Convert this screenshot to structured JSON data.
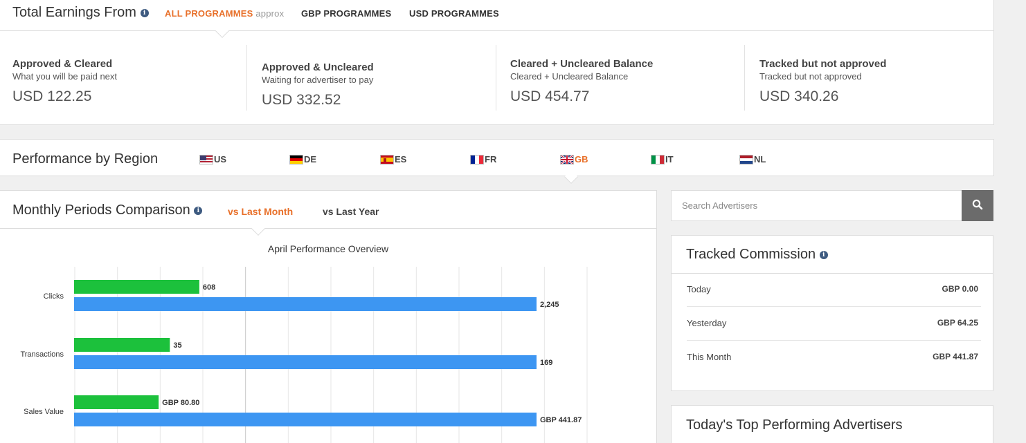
{
  "earnings": {
    "title": "Total Earnings From",
    "tabs": [
      {
        "label": "ALL PROGRAMMES",
        "suffix": "approx"
      },
      {
        "label": "GBP PROGRAMMES"
      },
      {
        "label": "USD PROGRAMMES"
      }
    ],
    "stats": [
      {
        "title": "Approved & Cleared",
        "subtitle": "What you will be paid next",
        "value": "USD 122.25"
      },
      {
        "title": "Approved & Uncleared",
        "subtitle": "Waiting for advertiser to pay",
        "value": "USD 332.52"
      },
      {
        "title": "Cleared + Uncleared Balance",
        "subtitle": "Cleared + Uncleared Balance",
        "value": "USD 454.77"
      },
      {
        "title": "Tracked but not approved",
        "subtitle": "Tracked but not approved",
        "value": "USD 340.26"
      }
    ]
  },
  "region": {
    "title": "Performance by Region",
    "items": [
      "US",
      "DE",
      "ES",
      "FR",
      "GB",
      "IT",
      "NL"
    ],
    "active": "GB"
  },
  "monthly": {
    "title": "Monthly Periods Comparison",
    "tabs": [
      "vs Last Month",
      "vs Last Year"
    ]
  },
  "search": {
    "placeholder": "Search Advertisers"
  },
  "tracked": {
    "title": "Tracked Commission",
    "rows": [
      {
        "label": "Today",
        "value": "GBP 0.00"
      },
      {
        "label": "Yesterday",
        "value": "GBP 64.25"
      },
      {
        "label": "This Month",
        "value": "GBP 441.87"
      }
    ]
  },
  "top_advertisers": {
    "title": "Today's Top Performing Advertisers"
  },
  "colors": {
    "accent": "#e8702a",
    "bar_green": "#1cc13c",
    "bar_blue": "#3d96f2",
    "info": "#3d5a80"
  },
  "chart_data": {
    "type": "bar",
    "orientation": "horizontal",
    "title": "April Performance Overview",
    "categories": [
      "Clicks",
      "Transactions",
      "Sales Value"
    ],
    "series": [
      {
        "color": "#1cc13c",
        "values": [
          608,
          35,
          80.8
        ],
        "labels": [
          "608",
          "35",
          "GBP 80.80"
        ]
      },
      {
        "color": "#3d96f2",
        "values": [
          2245,
          169,
          441.87
        ],
        "labels": [
          "2,245",
          "169",
          "GBP 441.87"
        ]
      }
    ],
    "grid": true
  }
}
